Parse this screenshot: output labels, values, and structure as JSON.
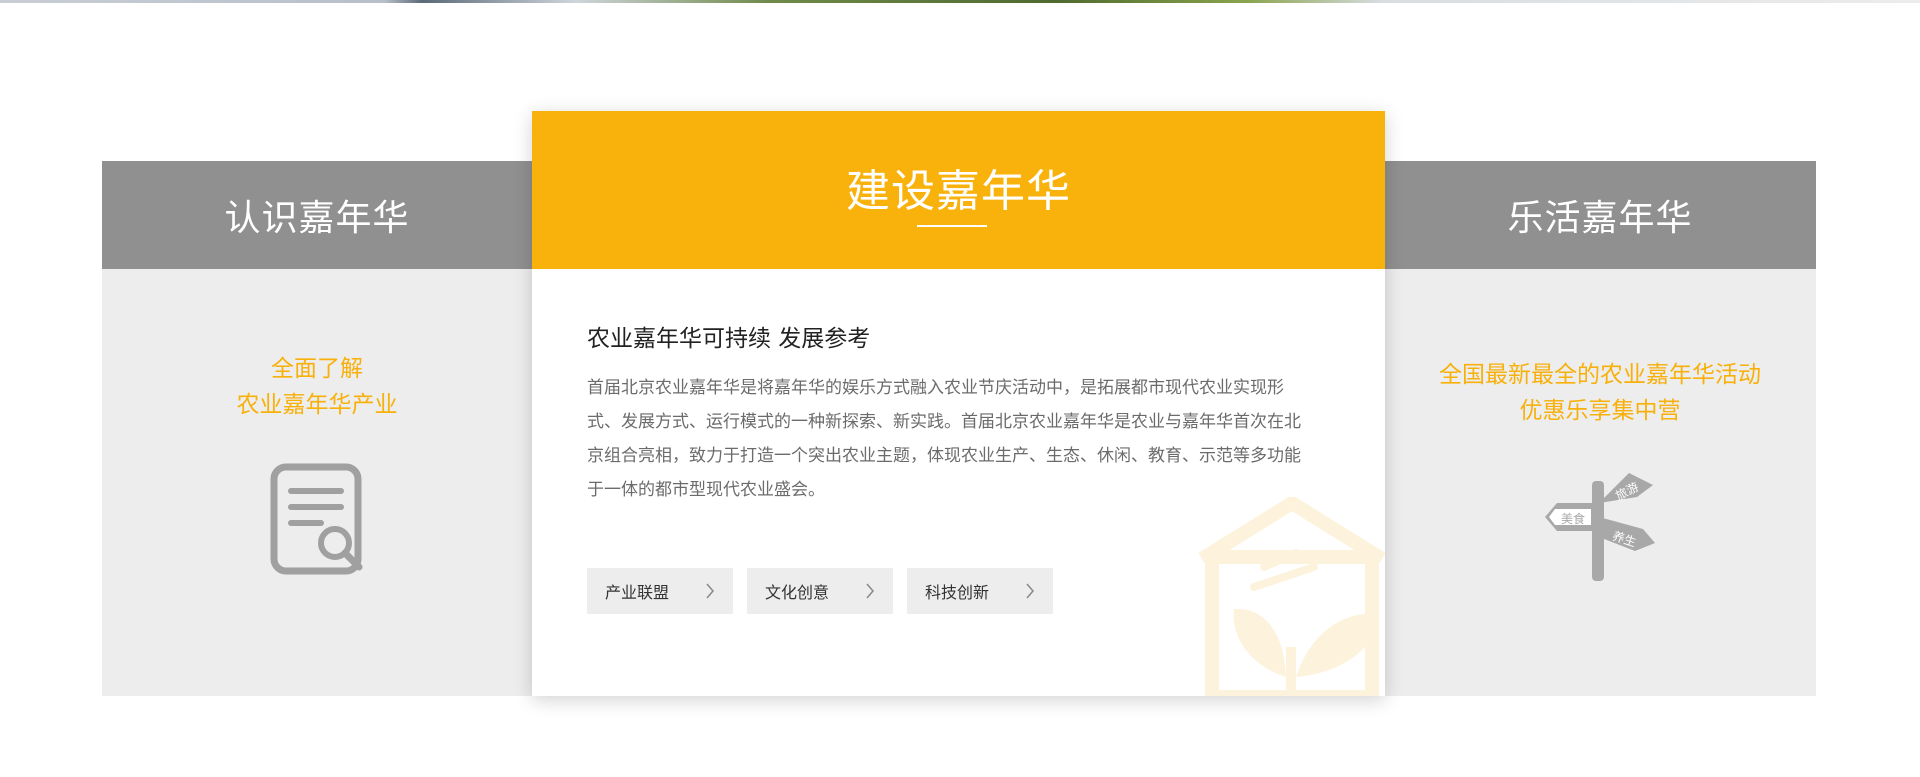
{
  "left_panel": {
    "title": "认识嘉年华",
    "subtitle_line1": "全面了解",
    "subtitle_line2": "农业嘉年华产业",
    "icon": "document-search-icon"
  },
  "center_panel": {
    "title": "建设嘉年华",
    "article_title": "农业嘉年华可持续 发展参考",
    "article_body": "首届北京农业嘉年华是将嘉年华的娱乐方式融入农业节庆活动中，是拓展都市现代农业实现形式、发展方式、运行模式的一种新探索、新实践。首届北京农业嘉年华是农业与嘉年华首次在北京组合亮相，致力于打造一个突出农业主题，体现农业生产、生态、休闲、教育、示范等多功能于一体的都市型现代农业盛会。",
    "tags": [
      {
        "label": "产业联盟"
      },
      {
        "label": "文化创意"
      },
      {
        "label": "科技创新"
      }
    ],
    "watermark_icon": "house-leaf-icon"
  },
  "right_panel": {
    "title": "乐活嘉年华",
    "subtitle_line1": "全国最新最全的农业嘉年华活动",
    "subtitle_line2": "优惠乐享集中营",
    "icon": "signpost-icon",
    "sign_labels": [
      "美食",
      "养生",
      "旅游"
    ]
  },
  "colors": {
    "accent": "#f8b20b",
    "side_header": "#909090",
    "side_background": "#ededed"
  }
}
